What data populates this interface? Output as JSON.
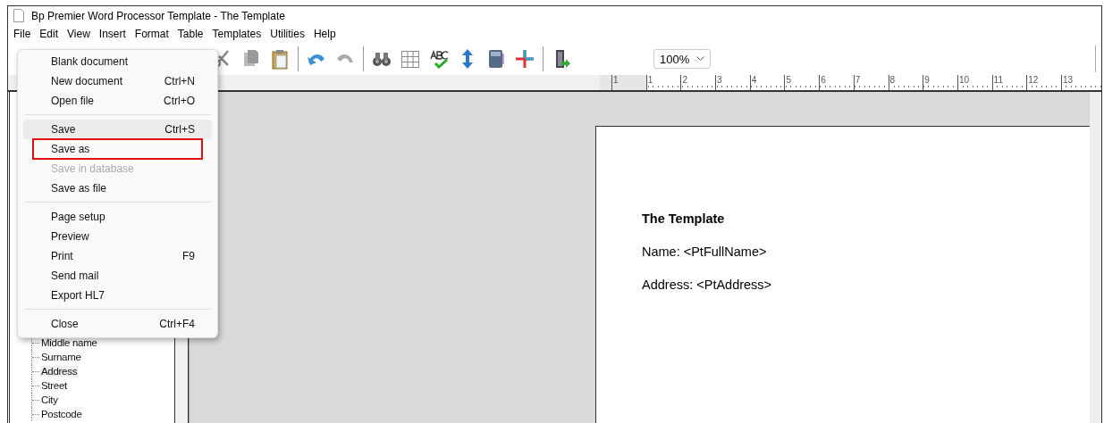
{
  "window": {
    "title": "Bp Premier Word Processor Template - The Template"
  },
  "menu_bar": [
    {
      "label": "File"
    },
    {
      "label": "Edit"
    },
    {
      "label": "View"
    },
    {
      "label": "Insert"
    },
    {
      "label": "Format"
    },
    {
      "label": "Table"
    },
    {
      "label": "Templates"
    },
    {
      "label": "Utilities"
    },
    {
      "label": "Help"
    }
  ],
  "file_menu": {
    "items": [
      {
        "kind": "item",
        "label": "Blank document",
        "disabled": false,
        "hovered": false,
        "annotated": false
      },
      {
        "kind": "item",
        "label": "New document",
        "shortcut": "Ctrl+N",
        "disabled": false,
        "hovered": false,
        "annotated": false
      },
      {
        "kind": "item",
        "label": "Open file",
        "shortcut": "Ctrl+O",
        "disabled": false,
        "hovered": false,
        "annotated": false
      },
      {
        "kind": "separator"
      },
      {
        "kind": "item",
        "label": "Save",
        "shortcut": "Ctrl+S",
        "disabled": false,
        "hovered": true,
        "annotated": false
      },
      {
        "kind": "item",
        "label": "Save as",
        "disabled": false,
        "hovered": false,
        "annotated": true
      },
      {
        "kind": "item",
        "label": "Save in database",
        "disabled": true,
        "hovered": false,
        "annotated": false
      },
      {
        "kind": "item",
        "label": "Save as file",
        "disabled": false,
        "hovered": false,
        "annotated": false
      },
      {
        "kind": "separator"
      },
      {
        "kind": "item",
        "label": "Page setup",
        "disabled": false,
        "hovered": false,
        "annotated": false
      },
      {
        "kind": "item",
        "label": "Preview",
        "disabled": false,
        "hovered": false,
        "annotated": false
      },
      {
        "kind": "item",
        "label": "Print",
        "shortcut": "F9",
        "disabled": false,
        "hovered": false,
        "annotated": false
      },
      {
        "kind": "item",
        "label": "Send mail",
        "disabled": false,
        "hovered": false,
        "annotated": false
      },
      {
        "kind": "item",
        "label": "Export HL7",
        "disabled": false,
        "hovered": false,
        "annotated": false
      },
      {
        "kind": "separator"
      },
      {
        "kind": "item",
        "label": "Close",
        "shortcut": "Ctrl+F4",
        "disabled": false,
        "hovered": false,
        "annotated": false
      }
    ]
  },
  "toolbar": {
    "zoom": "100%"
  },
  "ruler": {
    "labels": [
      "1",
      "1",
      "2",
      "3",
      "4",
      "5",
      "6",
      "7",
      "8",
      "9",
      "10",
      "11",
      "12",
      "13"
    ]
  },
  "field_tree": {
    "items": [
      {
        "label": "Middle name",
        "selected": false
      },
      {
        "label": "Surname",
        "selected": false
      },
      {
        "label": "Address",
        "selected": true
      },
      {
        "label": "Street",
        "selected": false
      },
      {
        "label": "City",
        "selected": false
      },
      {
        "label": "Postcode",
        "selected": false
      }
    ]
  },
  "document": {
    "heading": "The Template",
    "lines": [
      "Name: <PtFullName>",
      "Address: <PtAddress>"
    ]
  }
}
